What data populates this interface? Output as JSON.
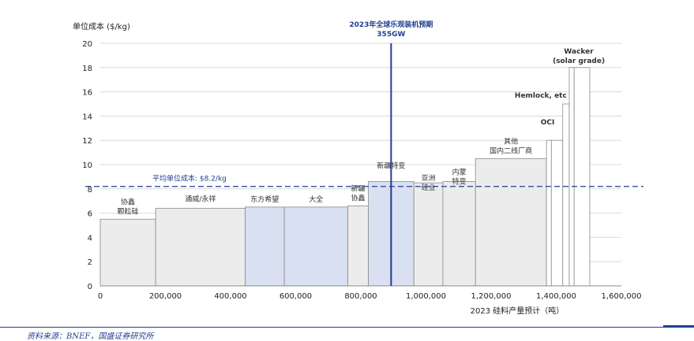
{
  "chart_data": {
    "type": "bar",
    "subtype": "supply-cost-curve (variable width)",
    "ylabel": "单位成本 ($/kg)",
    "xlabel": "2023 硅料产量预计（吨）",
    "xlim": [
      0,
      1600000
    ],
    "ylim": [
      0,
      20
    ],
    "xticks": [
      0,
      200000,
      400000,
      600000,
      800000,
      1000000,
      1200000,
      1400000,
      1600000
    ],
    "xtick_labels": [
      "0",
      "200,000",
      "400,000",
      "600,000",
      "800,000",
      "1,000,000",
      "1,200,000",
      "1,400,000",
      "1,600,000"
    ],
    "yticks": [
      0,
      2,
      4,
      6,
      8,
      10,
      12,
      14,
      16,
      18,
      20
    ],
    "ytick_labels": [
      "0",
      "2",
      "4",
      "6",
      "8",
      "10",
      "12",
      "14",
      "16",
      "18",
      "20"
    ],
    "grid": "horizontal",
    "segments": [
      {
        "label": "协鑫\n颗粒硅",
        "x0": 0,
        "x1": 170000,
        "y": 5.5,
        "fill": "#ececec"
      },
      {
        "label": "通威/永祥",
        "x0": 170000,
        "x1": 445000,
        "y": 6.4,
        "fill": "#ececec"
      },
      {
        "label": "东方希望",
        "x0": 445000,
        "x1": 565000,
        "y": 6.5,
        "fill": "#d8e0f2"
      },
      {
        "label": "大全",
        "x0": 565000,
        "x1": 760000,
        "y": 6.5,
        "fill": "#d8e0f2"
      },
      {
        "label": "新疆\n协鑫",
        "x0": 760000,
        "x1": 823000,
        "y": 6.6,
        "fill": "#ececec"
      },
      {
        "label": "新疆特变",
        "x0": 823000,
        "x1": 963000,
        "y": 8.6,
        "fill": "#d8e0f2"
      },
      {
        "label": "亚洲\n硅业",
        "x0": 963000,
        "x1": 1052000,
        "y": 8.5,
        "fill": "#ececec"
      },
      {
        "label": "内蒙\n特变",
        "x0": 1052000,
        "x1": 1152000,
        "y": 8.6,
        "fill": "#ececec"
      },
      {
        "label": "其他\n国内二线厂商",
        "x0": 1152000,
        "x1": 1370000,
        "y": 10.5,
        "fill": "#ececec"
      },
      {
        "label": "",
        "x0": 1370000,
        "x1": 1385000,
        "y": 12.0,
        "fill": "#ffffff"
      },
      {
        "label": "OCI",
        "x0": 1385000,
        "x1": 1420000,
        "y": 12.0,
        "fill": "#ffffff"
      },
      {
        "label": "Hemlock, etc",
        "x0": 1420000,
        "x1": 1440000,
        "y": 15.0,
        "fill": "#ffffff"
      },
      {
        "label": "",
        "x0": 1440000,
        "x1": 1455000,
        "y": 18.0,
        "fill": "#ffffff"
      },
      {
        "label": "Wacker\n(solar grade)",
        "x0": 1455000,
        "x1": 1503000,
        "y": 18.0,
        "fill": "#ffffff"
      }
    ],
    "average_line": {
      "label": "平均单位成本: $8.2/kg",
      "y": 8.2
    },
    "demand_line": {
      "label": "2023年全球乐观装机预期\n355GW",
      "x": 893000
    }
  },
  "source": "资料来源：BNEF，国盛证券研究所"
}
